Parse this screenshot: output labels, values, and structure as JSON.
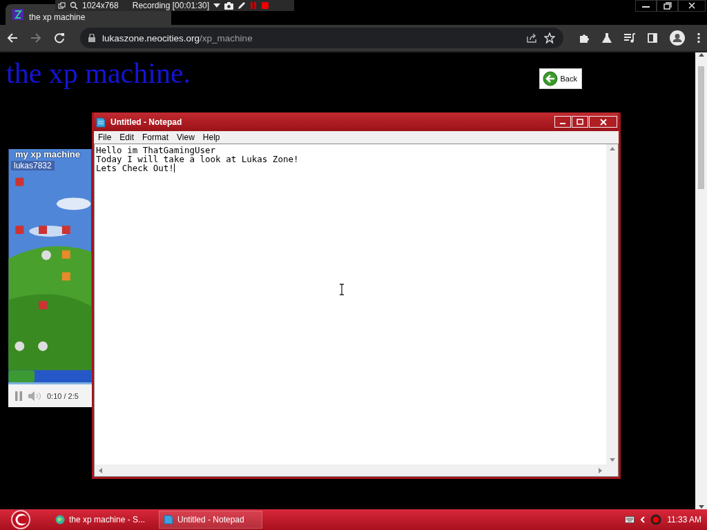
{
  "recording_bar": {
    "resolution": "1024x768",
    "status": "Recording [00:01:30]"
  },
  "browser": {
    "tab": {
      "title": "the xp machine",
      "selected": true
    },
    "address": {
      "domain": "lukaszone.neocities.org",
      "path": "/xp_machine"
    }
  },
  "page": {
    "heading": "the xp machine.",
    "back_button": "Back",
    "video": {
      "title": "my xp machine",
      "channel": "lukas7832",
      "time": "0:10 / 2:5",
      "playing": true
    }
  },
  "notepad": {
    "title": "Untitled - Notepad",
    "menu": [
      "File",
      "Edit",
      "Format",
      "View",
      "Help"
    ],
    "lines": [
      "Hello im ThatGamingUser",
      "Today I will take a look at Lukas Zone!",
      "Lets Check Out!"
    ]
  },
  "taskbar": {
    "tasks": [
      {
        "label": "the xp machine - S...",
        "selected": false
      },
      {
        "label": "Untitled - Notepad",
        "selected": true
      }
    ],
    "clock": "11:33 AM"
  }
}
